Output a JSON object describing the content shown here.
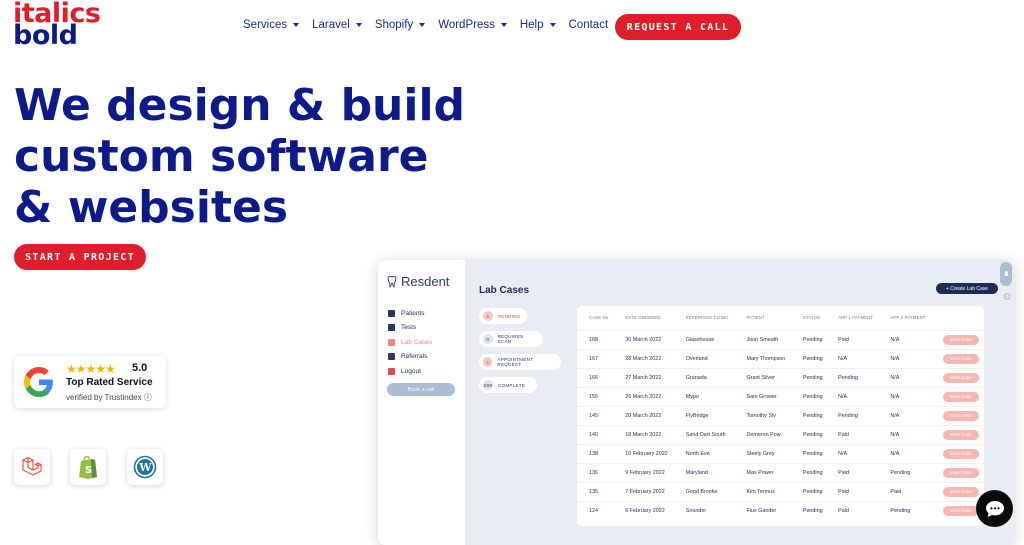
{
  "brand": {
    "line1": "italics",
    "line2": "bold"
  },
  "nav": {
    "items": [
      {
        "label": "Services",
        "dropdown": true
      },
      {
        "label": "Laravel",
        "dropdown": true
      },
      {
        "label": "Shopify",
        "dropdown": true
      },
      {
        "label": "WordPress",
        "dropdown": true
      },
      {
        "label": "Help",
        "dropdown": true
      },
      {
        "label": "Contact",
        "dropdown": false
      }
    ],
    "cta": "REQUEST A CALL"
  },
  "hero": {
    "line1": "We design & build",
    "line2": "custom software",
    "line3": "& websites",
    "cta": "START A PROJECT"
  },
  "badge": {
    "stars": "★★★★★",
    "score": "5.0",
    "title": "Top Rated Service",
    "verified": "verified by Trustindex ⓘ"
  },
  "tech_icons": [
    "laravel-icon",
    "shopify-icon",
    "wordpress-icon"
  ],
  "dashboard": {
    "brand": "Resdent",
    "nav": [
      {
        "label": "Patients",
        "active": false
      },
      {
        "label": "Tests",
        "active": false
      },
      {
        "label": "Lab Cases",
        "active": true
      },
      {
        "label": "Referrals",
        "active": false
      },
      {
        "label": "Logout",
        "active": false
      }
    ],
    "book_label": "Book a call",
    "title": "Lab Cases",
    "create_label": "+ Create Lab Case",
    "filters": [
      {
        "count": "5",
        "label": "PENDING"
      },
      {
        "count": "0",
        "label": "REQUIRES SCAN"
      },
      {
        "count": "2",
        "label": "APPOINTMENT REQUEST"
      },
      {
        "count": "208",
        "label": "COMPLETE"
      }
    ],
    "columns": [
      "CASE No.",
      "DATE ORDERED",
      "REFERRING CLINIC",
      "PATIENT",
      "STATUS",
      "APP 1 PAYMENT",
      "APP 2 PAYMENT",
      ""
    ],
    "rows": [
      [
        "168",
        "30 March 2022",
        "Glasshouse",
        "Joon Smeath",
        "Pending",
        "Paid",
        "N/A",
        "View Case"
      ],
      [
        "167",
        "28 March 2022",
        "Overland",
        "Mary Thompson",
        "Pending",
        "N/A",
        "N/A",
        "View Case"
      ],
      [
        "166",
        "27 March 2022",
        "Granada",
        "Grant Silver",
        "Pending",
        "Pending",
        "N/A",
        "View Case"
      ],
      [
        "156",
        "26 March 2022",
        "Mypo",
        "Sam Grower",
        "Pending",
        "N/A",
        "N/A",
        "View Case"
      ],
      [
        "145",
        "20 March 2022",
        "FlyBridge",
        "Tomothy Sly",
        "Pending",
        "Pending",
        "N/A",
        "View Case"
      ],
      [
        "140",
        "18 March 2022",
        "Sand Dart South",
        "Demeron Pow",
        "Pending",
        "Paid",
        "N/A",
        "View Case"
      ],
      [
        "138",
        "10 February 2022",
        "North Eve",
        "Steely Grey",
        "Pending",
        "N/A",
        "N/A",
        "View Case"
      ],
      [
        "136",
        "9 February 2022",
        "Maryland",
        "Max Power",
        "Pending",
        "Paid",
        "Pending",
        "View Case"
      ],
      [
        "135",
        "7 February 2022",
        "Good Brooke",
        "Kim Termus",
        "Pending",
        "Paid",
        "Paid",
        "View Case"
      ],
      [
        "124",
        "6 February 2022",
        "Sounder",
        "Flux Gander",
        "Pending",
        "Paid",
        "Pending",
        "View Case"
      ]
    ]
  },
  "colors": {
    "brand_red": "#e01e2b",
    "brand_navy": "#0c1a8a"
  }
}
